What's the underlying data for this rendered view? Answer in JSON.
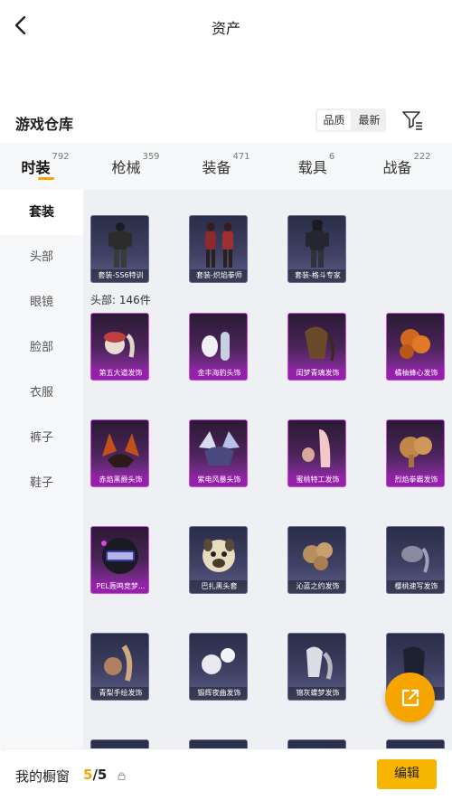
{
  "header": {
    "title": "资产",
    "back_icon": "back-arrow-icon"
  },
  "warehouse": {
    "title": "游戏仓库",
    "sort_options": [
      "品质",
      "最新"
    ],
    "sort_selected": "品质",
    "filter_icon": "filter-icon"
  },
  "tabs": [
    {
      "label": "时装",
      "count": "792",
      "active": true
    },
    {
      "label": "枪械",
      "count": "359",
      "active": false
    },
    {
      "label": "装备",
      "count": "471",
      "active": false
    },
    {
      "label": "载具",
      "count": "6",
      "active": false
    },
    {
      "label": "战备",
      "count": "222",
      "active": false
    }
  ],
  "sidebar": {
    "items": [
      {
        "label": "套装",
        "active": true
      },
      {
        "label": "头部",
        "active": false
      },
      {
        "label": "眼镜",
        "active": false
      },
      {
        "label": "脸部",
        "active": false
      },
      {
        "label": "衣服",
        "active": false
      },
      {
        "label": "裤子",
        "active": false
      },
      {
        "label": "鞋子",
        "active": false
      }
    ]
  },
  "suits": [
    {
      "name": "套装-SS6特训",
      "quality": "blue"
    },
    {
      "name": "套装-炽焰拳师",
      "quality": "blue"
    },
    {
      "name": "套装-格斗专家",
      "quality": "blue"
    }
  ],
  "head_section": {
    "label": "头部: 146件"
  },
  "head_items": [
    {
      "name": "第五大道发饰",
      "quality": "purple"
    },
    {
      "name": "金丰海豹头饰",
      "quality": "purple"
    },
    {
      "name": "闺梦青璃发饰",
      "quality": "purple"
    },
    {
      "name": "橘柚蜂心发饰",
      "quality": "purple"
    },
    {
      "name": "赤焰黑爵头饰",
      "quality": "purple"
    },
    {
      "name": "紫电风暴头饰",
      "quality": "purple"
    },
    {
      "name": "蜜桃特工发饰",
      "quality": "purple"
    },
    {
      "name": "烈焰拳霸发饰",
      "quality": "purple"
    },
    {
      "name": "PEL轰鸣竞梦...",
      "quality": "purple"
    },
    {
      "name": "巴扎黑头套",
      "quality": "blue"
    },
    {
      "name": "沁蓝之约发饰",
      "quality": "blue"
    },
    {
      "name": "樱桃速写发饰",
      "quality": "blue"
    },
    {
      "name": "青梨手绘发饰",
      "quality": "blue"
    },
    {
      "name": "锻辉夜曲发饰",
      "quality": "blue"
    },
    {
      "name": "锦灰蝶梦发饰",
      "quality": "blue"
    },
    {
      "name": "",
      "quality": "blue"
    }
  ],
  "fab": {
    "icon": "share-icon"
  },
  "bottom": {
    "label": "我的橱窗",
    "current": "5",
    "separator": "/",
    "total": "5",
    "lock_icon": "lock-icon",
    "edit_label": "编辑"
  },
  "colors": {
    "accent": "#f5a400",
    "purple_quality": "#c44fd8",
    "blue_quality": "#6a6c96"
  }
}
